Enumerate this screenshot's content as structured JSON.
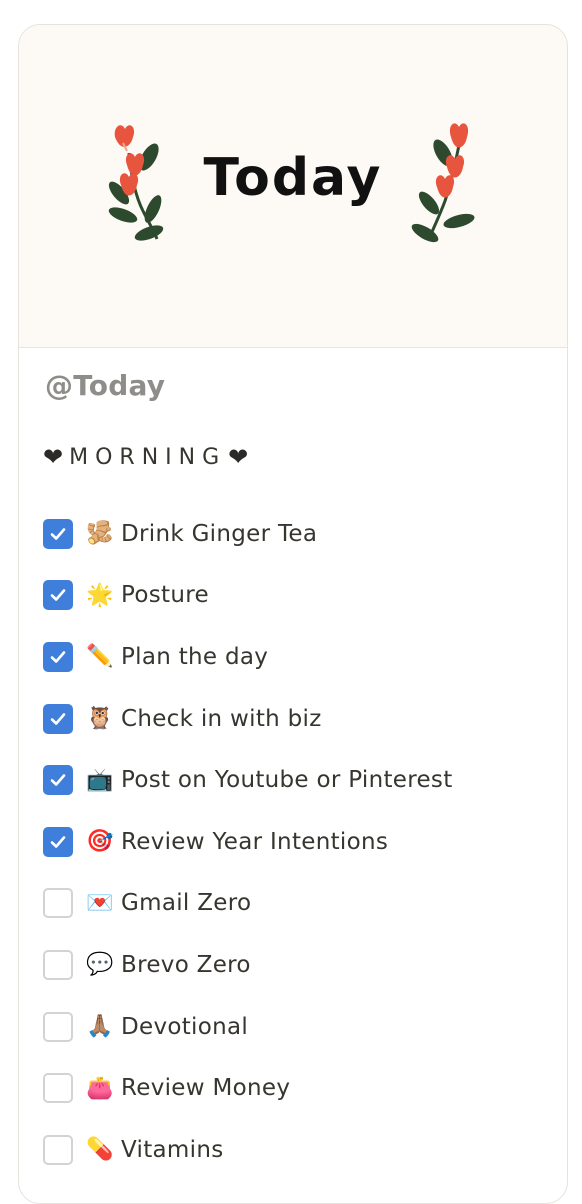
{
  "cover": {
    "title": "Today"
  },
  "page": {
    "mention": "@Today"
  },
  "section": {
    "heart_left": "❤",
    "title": "MORNING",
    "heart_right": "❤"
  },
  "todos": [
    {
      "emoji": "🫚",
      "emoji_name": "ginger-icon",
      "label": "Drink Ginger Tea",
      "checked": true
    },
    {
      "emoji": "🌟",
      "emoji_name": "star-icon",
      "label": "Posture",
      "checked": true
    },
    {
      "emoji": "✏️",
      "emoji_name": "pencil-icon",
      "label": "Plan the day",
      "checked": true
    },
    {
      "emoji": "🦉",
      "emoji_name": "owl-icon",
      "label": "Check in with biz",
      "checked": true
    },
    {
      "emoji": "📺",
      "emoji_name": "television-icon",
      "label": "Post on Youtube or Pinterest",
      "checked": true
    },
    {
      "emoji": "🎯",
      "emoji_name": "target-icon",
      "label": "Review Year Intentions",
      "checked": true
    },
    {
      "emoji": "💌",
      "emoji_name": "love-letter-icon",
      "label": "Gmail Zero",
      "checked": false
    },
    {
      "emoji": "💬",
      "emoji_name": "speech-bubble-icon",
      "label": "Brevo Zero",
      "checked": false
    },
    {
      "emoji": "🙏🏽",
      "emoji_name": "praying-hands-icon",
      "label": "Devotional",
      "checked": false
    },
    {
      "emoji": "👛",
      "emoji_name": "purse-icon",
      "label": "Review Money",
      "checked": false
    },
    {
      "emoji": "💊",
      "emoji_name": "pill-icon",
      "label": "Vitamins",
      "checked": false
    }
  ],
  "colors": {
    "checkbox_checked": "#3f7fdb",
    "checkbox_unchecked_border": "#d5d3cf",
    "cover_background": "#fdf9f4",
    "flower_red": "#e8553f",
    "leaf_green": "#2e4a2e",
    "text": "#37352f",
    "mention_gray": "#8f8d8a"
  }
}
